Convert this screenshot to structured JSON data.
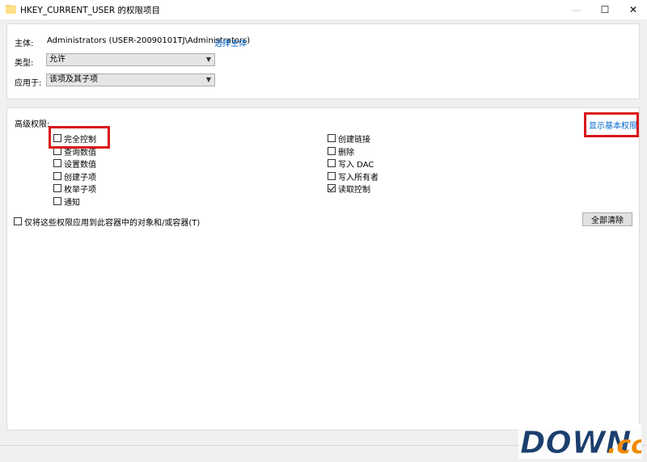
{
  "window": {
    "title": "HKEY_CURRENT_USER 的权限项目",
    "folder_icon": "folder-icon",
    "minimize": "—",
    "maximize": "☐",
    "close": "✕"
  },
  "principal": {
    "label": "主体:",
    "value": "Administrators (USER-20090101TJ\\Administrators)",
    "select_link": "选择主体"
  },
  "type": {
    "label": "类型:",
    "value": "允许"
  },
  "applies": {
    "label": "应用于:",
    "value": "该项及其子项"
  },
  "advanced": {
    "label": "高级权限:",
    "show_basic_link": "显示基本权限",
    "left": [
      {
        "label": "完全控制",
        "checked": false
      },
      {
        "label": "查询数值",
        "checked": false
      },
      {
        "label": "设置数值",
        "checked": false
      },
      {
        "label": "创建子项",
        "checked": false
      },
      {
        "label": "枚举子项",
        "checked": false
      },
      {
        "label": "通知",
        "checked": false
      }
    ],
    "right": [
      {
        "label": "创建链接",
        "checked": false
      },
      {
        "label": "删除",
        "checked": false
      },
      {
        "label": "写入 DAC",
        "checked": false
      },
      {
        "label": "写入所有者",
        "checked": false
      },
      {
        "label": "读取控制",
        "checked": true
      }
    ],
    "apply_only_label": "仅将这些权限应用到此容器中的对象和/或容器(T)",
    "clear_all": "全部清除"
  },
  "watermark": {
    "text": "DOWN",
    "suffix": ".cc"
  },
  "colors": {
    "link": "#0066cc",
    "highlight_box": "#d9161c",
    "watermark_blue": "#1b3f6e",
    "watermark_orange": "#f08a00"
  }
}
